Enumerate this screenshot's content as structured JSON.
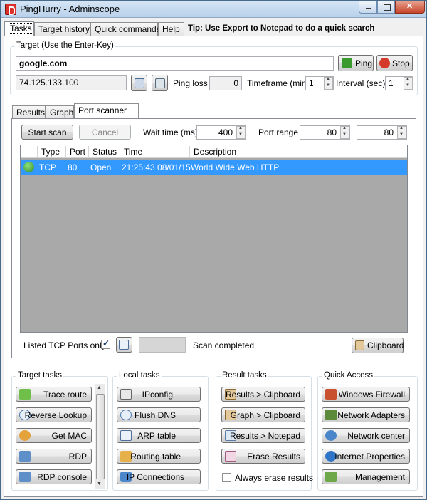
{
  "window": {
    "title": "PingHurry - Adminscope"
  },
  "top_tabs": [
    {
      "label": "Tasks",
      "active": true
    },
    {
      "label": "Target history",
      "active": false
    },
    {
      "label": "Quick commands",
      "active": false
    },
    {
      "label": "Help",
      "active": false
    }
  ],
  "tip": "Tip: Use Export to Notepad to do a quick search",
  "target": {
    "group_title": "Target (Use the Enter-Key)",
    "host_value": "google.com",
    "ip_value": "74.125.133.100",
    "ping_label": "Ping",
    "stop_label": "Stop",
    "ping_loss_label": "Ping loss",
    "ping_loss_value": "0",
    "timeframe_label": "Timeframe (min)",
    "timeframe_value": "1",
    "interval_label": "Interval (sec)",
    "interval_value": "1"
  },
  "inner_tabs": [
    {
      "label": "Results",
      "active": false
    },
    {
      "label": "Graph",
      "active": false
    },
    {
      "label": "Port scanner",
      "active": true
    }
  ],
  "scanner": {
    "start_label": "Start scan",
    "cancel_label": "Cancel",
    "wait_label": "Wait time (ms)",
    "wait_value": "400",
    "range_label": "Port range",
    "range_from": "80",
    "range_to": "80",
    "columns": [
      "Type",
      "Port",
      "Status",
      "Time",
      "Description"
    ],
    "rows": [
      {
        "type": "TCP",
        "port": "80",
        "status": "Open",
        "time": "21:25:43 08/01/15",
        "description": "World Wide Web HTTP"
      }
    ],
    "listed_only_label": "Listed TCP Ports only",
    "listed_only_checked": true,
    "status_text": "Scan completed",
    "clipboard_label": "Clipboard"
  },
  "target_tasks": {
    "title": "Target tasks",
    "items": [
      "Trace route",
      "Reverse Lookup",
      "Get MAC",
      "RDP",
      "RDP console"
    ]
  },
  "local_tasks": {
    "title": "Local tasks",
    "items": [
      "IPconfig",
      "Flush DNS",
      "ARP table",
      "Routing table",
      "IP Connections"
    ]
  },
  "result_tasks": {
    "title": "Result tasks",
    "items": [
      "Results > Clipboard",
      "Graph > Clipboard",
      "Results > Notepad",
      "Erase Results"
    ],
    "always_erase_label": "Always erase results",
    "always_erase_checked": false
  },
  "quick_access": {
    "title": "Quick Access",
    "items": [
      "Windows Firewall",
      "Network Adapters",
      "Network center",
      "Internet Properties",
      "Management"
    ]
  },
  "colors": {
    "selection": "#3399ff",
    "grid_background": "#a9a9a9",
    "ping_icon": "#3a9a2e",
    "stop_icon": "#d33a2a"
  }
}
